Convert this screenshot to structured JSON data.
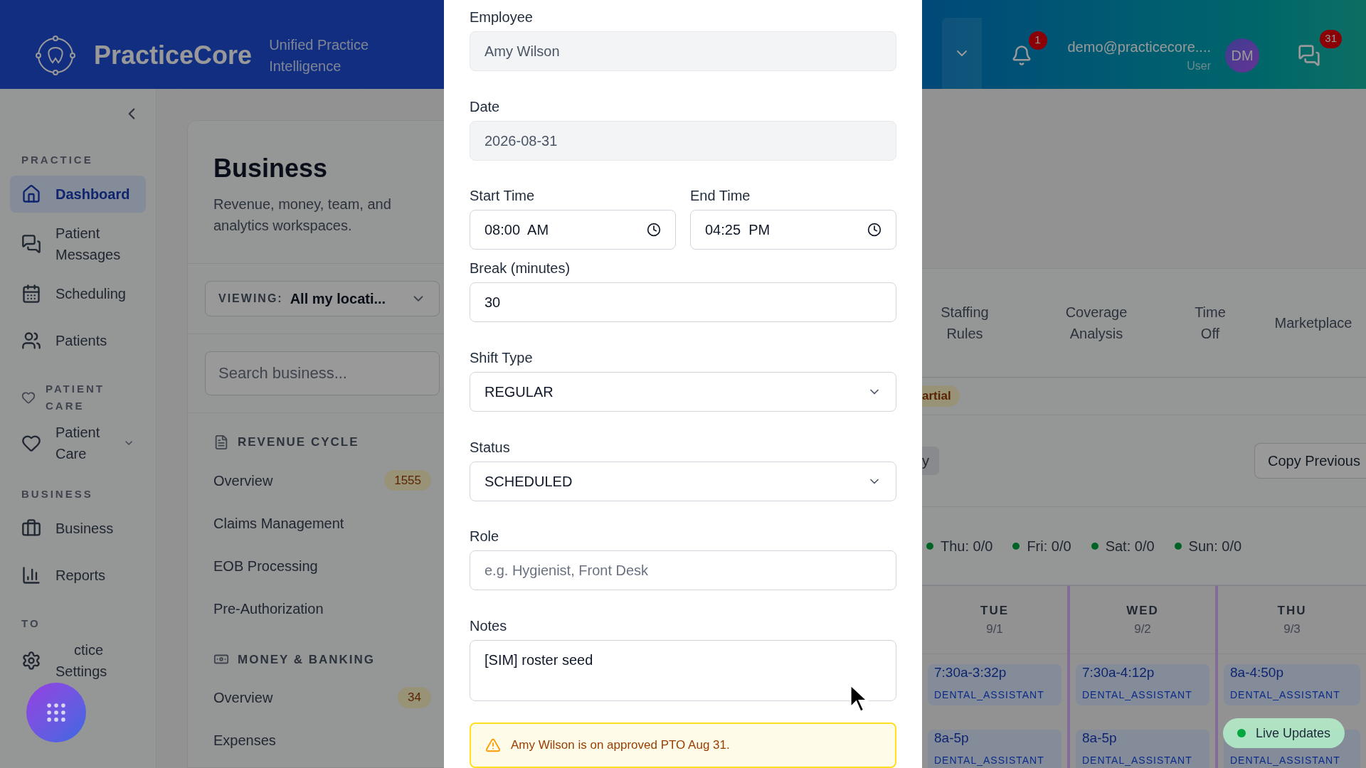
{
  "header": {
    "brand": "PracticeCore",
    "tagline": "Unified Practice Intelligence",
    "notifications": "1",
    "user_email": "demo@practicecore....",
    "user_role": "User",
    "avatar": "DM",
    "messages": "31"
  },
  "sidebar": {
    "sections": [
      {
        "heading": "PRACTICE",
        "items": [
          {
            "label": "Dashboard",
            "selected": true
          },
          {
            "label": "Patient Messages",
            "selected": false
          },
          {
            "label": "Scheduling",
            "selected": false
          },
          {
            "label": "Patients",
            "selected": false
          }
        ]
      },
      {
        "heading": "PATIENT CARE",
        "items": [
          {
            "label": "Patient Care",
            "selected": false,
            "expandable": true
          }
        ]
      },
      {
        "heading": "BUSINESS",
        "items": [
          {
            "label": "Business",
            "selected": false
          },
          {
            "label": "Reports",
            "selected": false
          }
        ]
      },
      {
        "heading": "TO",
        "items": [
          {
            "label": "ctice Settings",
            "selected": false,
            "covered": true
          }
        ]
      }
    ]
  },
  "business": {
    "title": "Business",
    "subtitle": "Revenue, money, team, and analytics workspaces.",
    "viewing_label": "VIEWING:",
    "viewing_value": "All my locati...",
    "search": {
      "placeholder": "Search business..."
    },
    "groups": [
      {
        "heading": "REVENUE CYCLE",
        "items": [
          {
            "label": "Overview",
            "count": "1555"
          },
          {
            "label": "Claims Management"
          },
          {
            "label": "EOB Processing"
          },
          {
            "label": "Pre-Authorization"
          }
        ]
      },
      {
        "heading": "MONEY & BANKING",
        "items": [
          {
            "label": "Overview",
            "count": "34"
          },
          {
            "label": "Expenses"
          }
        ]
      }
    ]
  },
  "schedule": {
    "tabs": [
      "Staffing Rules",
      "Coverage Analysis",
      "Time Off",
      "Marketplace"
    ],
    "badge": "artial",
    "button_fragment": "y",
    "copy_button": "Copy Previous",
    "summary": [
      "Thu: 0/0",
      "Fri: 0/0",
      "Sat: 0/0",
      "Sun: 0/0"
    ],
    "days": [
      {
        "day": "TUE",
        "date": "9/1",
        "shifts": [
          {
            "time": "7:30a-3:32p",
            "role": "DENTAL_ASSISTANT"
          },
          {
            "time": "8a-5p",
            "role": "DENTAL_ASSISTANT"
          }
        ]
      },
      {
        "day": "WED",
        "date": "9/2",
        "shifts": [
          {
            "time": "7:30a-4:12p",
            "role": "DENTAL_ASSISTANT"
          },
          {
            "time": "8a-5p",
            "role": "DENTAL_ASSISTANT"
          }
        ]
      },
      {
        "day": "THU",
        "date": "9/3",
        "shifts": [
          {
            "time": "8a-4:50p",
            "role": "DENTAL_ASSISTANT"
          },
          {
            "role": "DENTAL_ASSISTANT"
          }
        ]
      }
    ],
    "live": "Live Updates"
  },
  "fab": {
    "kind": "grid"
  },
  "modal": {
    "fields": [
      {
        "label": "Employee",
        "kind": "readonly",
        "value": "Amy Wilson"
      },
      {
        "label": "Date",
        "kind": "readonly",
        "value": "2026-08-31"
      },
      {
        "kind": "pair",
        "fields": [
          {
            "label": "Start Time",
            "kind": "time",
            "value": "08:00  AM"
          },
          {
            "label": "End Time",
            "kind": "time",
            "value": "04:25  PM"
          }
        ]
      },
      {
        "label": "Break (minutes)",
        "kind": "text",
        "value": "30"
      },
      {
        "label": "Shift Type",
        "kind": "select",
        "value": "REGULAR"
      },
      {
        "label": "Status",
        "kind": "select",
        "value": "SCHEDULED"
      },
      {
        "label": "Role",
        "kind": "text",
        "placeholder": "e.g. Hygienist, Front Desk"
      },
      {
        "label": "Notes",
        "kind": "textarea",
        "value": "[SIM] roster seed"
      }
    ],
    "alert": "Amy Wilson is on approved PTO Aug 31."
  }
}
